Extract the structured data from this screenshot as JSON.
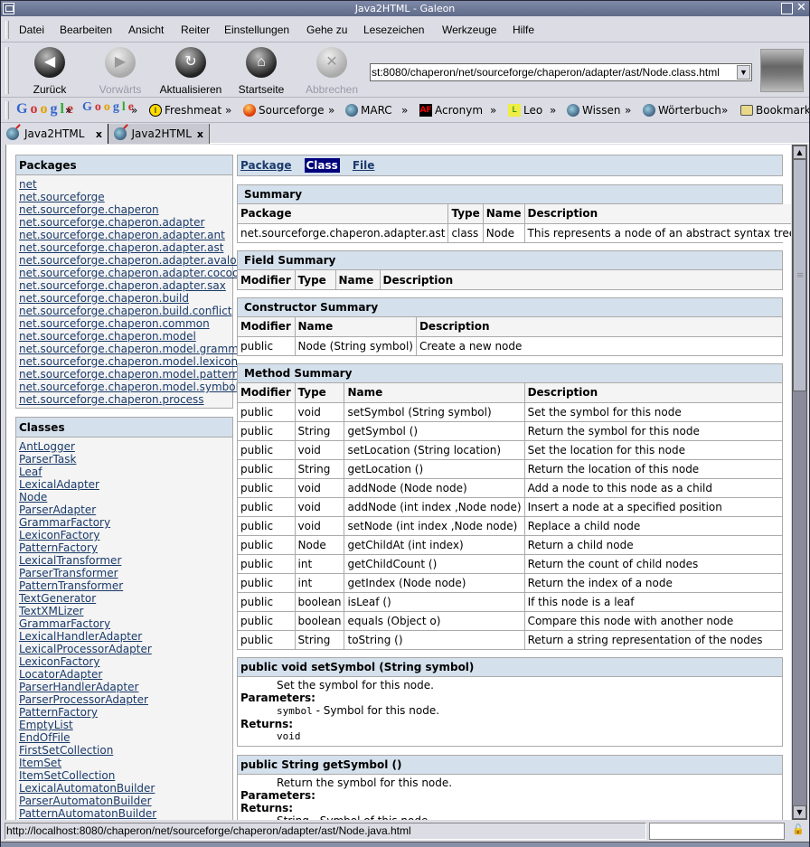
{
  "window": {
    "title": "Java2HTML - Galeon"
  },
  "menubar": {
    "items": [
      "Datei",
      "Bearbeiten",
      "Ansicht",
      "Reiter",
      "Einstellungen",
      "Gehe zu",
      "Lesezeichen",
      "Werkzeuge",
      "Hilfe"
    ]
  },
  "toolbar": {
    "back": "Zurück",
    "forward": "Vorwärts",
    "reload": "Aktualisieren",
    "home": "Startseite",
    "stop": "Abbrechen",
    "url": "st:8080/chaperon/net/sourceforge/chaperon/adapter/ast/Node.class.html"
  },
  "bookmarks": {
    "google": "Google",
    "google_groups": "Google GROUPS",
    "items": [
      "Freshmeat",
      "Sourceforge",
      "MARC",
      "Acronym",
      "Leo",
      "Wissen",
      "Wörterbuch",
      "Bookmarklets"
    ],
    "separator": "»"
  },
  "tabs": [
    {
      "label": "Java2HTML",
      "active": true
    },
    {
      "label": "Java2HTML",
      "active": false
    }
  ],
  "tab_close": "x",
  "sidebar": {
    "packages_title": "Packages",
    "packages": [
      "net",
      "net.sourceforge",
      "net.sourceforge.chaperon",
      "net.sourceforge.chaperon.adapter",
      "net.sourceforge.chaperon.adapter.ant",
      "net.sourceforge.chaperon.adapter.ast",
      "net.sourceforge.chaperon.adapter.avalon",
      "net.sourceforge.chaperon.adapter.cocoon",
      "net.sourceforge.chaperon.adapter.sax",
      "net.sourceforge.chaperon.build",
      "net.sourceforge.chaperon.build.conflict",
      "net.sourceforge.chaperon.common",
      "net.sourceforge.chaperon.model",
      "net.sourceforge.chaperon.model.grammar",
      "net.sourceforge.chaperon.model.lexicon",
      "net.sourceforge.chaperon.model.pattern",
      "net.sourceforge.chaperon.model.symbol",
      "net.sourceforge.chaperon.process"
    ],
    "classes_title": "Classes",
    "classes": [
      "AntLogger",
      "ParserTask",
      "Leaf",
      "LexicalAdapter",
      "Node",
      "ParserAdapter",
      "GrammarFactory",
      "LexiconFactory",
      "PatternFactory",
      "LexicalTransformer",
      "ParserTransformer",
      "PatternTransformer",
      "TextGenerator",
      "TextXMLizer",
      "GrammarFactory",
      "LexicalHandlerAdapter",
      "LexicalProcessorAdapter",
      "LexiconFactory",
      "LocatorAdapter",
      "ParserHandlerAdapter",
      "ParserProcessorAdapter",
      "PatternFactory",
      "EmptyList",
      "EndOfFile",
      "FirstSetCollection",
      "ItemSet",
      "ItemSetCollection",
      "LexicalAutomatonBuilder",
      "ParserAutomatonBuilder",
      "PatternAutomatonBuilder"
    ]
  },
  "nav": {
    "package": "Package",
    "class": "Class",
    "file": "File"
  },
  "summary": {
    "title": "Summary",
    "headers": [
      "Package",
      "Type",
      "Name",
      "Description"
    ],
    "row": [
      "net.sourceforge.chaperon.adapter.ast",
      "class",
      "Node",
      "This represents a node of an abstract syntax tree"
    ]
  },
  "field_summary": {
    "title": "Field Summary",
    "headers": [
      "Modifier",
      "Type",
      "Name",
      "Description"
    ]
  },
  "constructor_summary": {
    "title": "Constructor Summary",
    "headers": [
      "Modifier",
      "Name",
      "Description"
    ],
    "rows": [
      [
        "public",
        "Node (String symbol)",
        "Create a new node"
      ]
    ]
  },
  "method_summary": {
    "title": "Method Summary",
    "headers": [
      "Modifier",
      "Type",
      "Name",
      "Description"
    ],
    "rows": [
      [
        "public",
        "void",
        "setSymbol (String symbol)",
        "Set the symbol for this node"
      ],
      [
        "public",
        "String",
        "getSymbol ()",
        "Return the symbol for this node"
      ],
      [
        "public",
        "void",
        "setLocation (String location)",
        "Set the location for this node"
      ],
      [
        "public",
        "String",
        "getLocation ()",
        "Return the location of this node"
      ],
      [
        "public",
        "void",
        "addNode (Node node)",
        "Add a node to this node as a child"
      ],
      [
        "public",
        "void",
        "addNode (int index ,Node node)",
        "Insert a node at a specified position"
      ],
      [
        "public",
        "void",
        "setNode (int index ,Node node)",
        "Replace a child node"
      ],
      [
        "public",
        "Node",
        "getChildAt (int index)",
        "Return a child node"
      ],
      [
        "public",
        "int",
        "getChildCount ()",
        "Return the count of child nodes"
      ],
      [
        "public",
        "int",
        "getIndex (Node node)",
        "Return the index of a node"
      ],
      [
        "public",
        "boolean",
        "isLeaf ()",
        "If this node is a leaf"
      ],
      [
        "public",
        "boolean",
        "equals (Object o)",
        "Compare this node with another node"
      ],
      [
        "public",
        "String",
        "toString ()",
        "Return a string representation of the nodes"
      ]
    ]
  },
  "details": [
    {
      "signature": "public  void  setSymbol (String symbol)",
      "description": "Set the symbol for this node.",
      "params_label": "Parameters:",
      "param_name": "symbol",
      "param_desc": " - Symbol for this node.",
      "returns_label": "Returns:",
      "returns": "void"
    },
    {
      "signature": "public  String  getSymbol ()",
      "description": "Return the symbol for this node.",
      "params_label": "Parameters:",
      "returns_label": "Returns:",
      "returns_partial": "String - Symbol of this node."
    }
  ],
  "statusbar": {
    "message": "http://localhost:8080/chaperon/net/sourceforge/chaperon/adapter/ast/Node.java.html"
  },
  "scroll": {
    "position_fraction": 0.0,
    "visible_fraction": 0.36
  }
}
